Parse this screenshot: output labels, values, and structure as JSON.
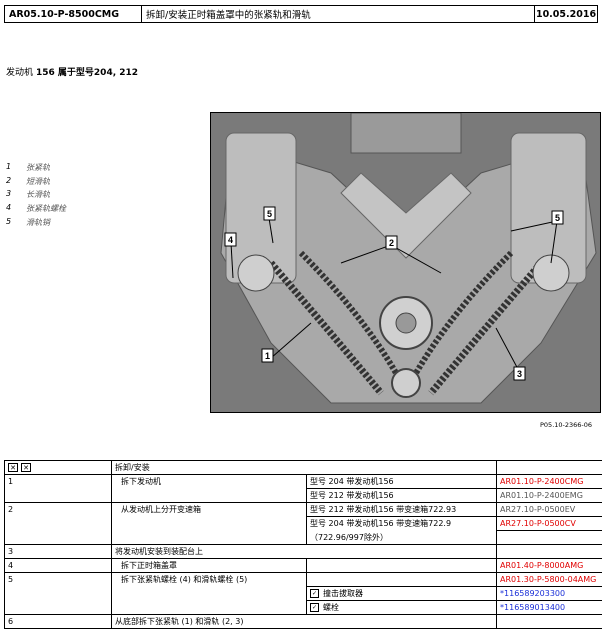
{
  "header": {
    "doc_code": "AR05.10-P-8500CMG",
    "title": "拆卸/安装正时箱盖罩中的张紧轨和滑轨",
    "date": "10.05.2016"
  },
  "engine": {
    "label": "发动机",
    "description": "156 属于型号204, 212"
  },
  "legend": [
    {
      "num": "1",
      "text": "张紧轨"
    },
    {
      "num": "2",
      "text": "短滑轨"
    },
    {
      "num": "3",
      "text": "长滑轨"
    },
    {
      "num": "4",
      "text": "张紧轨螺栓"
    },
    {
      "num": "5",
      "text": "滑轨销"
    }
  ],
  "figure": {
    "code": "P05.10-2366-06",
    "callouts": [
      "1",
      "2",
      "3",
      "4",
      "5",
      "5"
    ]
  },
  "table": {
    "header_text": "拆卸/安装",
    "rows": [
      {
        "num": "1",
        "step": "拆下发动机",
        "details": [
          {
            "text": "型号 204 带发动机156",
            "ref": "AR01.10-P-2400CMG",
            "ref_color": "red"
          },
          {
            "text": "型号 212 带发动机156",
            "ref": "AR01.10-P-2400EMG",
            "ref_color": "grey"
          }
        ]
      },
      {
        "num": "2",
        "step": "从发动机上分开变速箱",
        "details": [
          {
            "text": "型号 212 带发动机156 带变速箱722.93",
            "ref": "AR27.10-P-0500EV",
            "ref_color": "grey"
          },
          {
            "text": "型号 204 带发动机156 带变速箱722.9",
            "ref": "AR27.10-P-0500CV",
            "ref_color": "red"
          },
          {
            "text": "（722.96/997除外）",
            "ref": "",
            "ref_color": "grey"
          }
        ]
      },
      {
        "num": "3",
        "step": "将发动机安装到装配台上",
        "details": []
      },
      {
        "num": "4",
        "step": "拆下正时箱盖罩",
        "details": [
          {
            "text": "",
            "ref": "AR01.40-P-8000AMG",
            "ref_color": "red"
          }
        ]
      },
      {
        "num": "5",
        "step": "拆下张紧轨螺栓 (4) 和滑轨螺栓 (5)",
        "details": [
          {
            "text": "",
            "ref": "AR01.30-P-5800-04AMG",
            "ref_color": "red"
          },
          {
            "text": "撞击拔取器",
            "ref": "*116589203300",
            "ref_color": "blue",
            "tool": true
          },
          {
            "text": "螺栓",
            "ref": "*116589013400",
            "ref_color": "blue",
            "tool": true
          }
        ]
      },
      {
        "num": "6",
        "step": "从底部拆下张紧轨 (1) 和滑轨 (2, 3)",
        "details": []
      }
    ]
  }
}
